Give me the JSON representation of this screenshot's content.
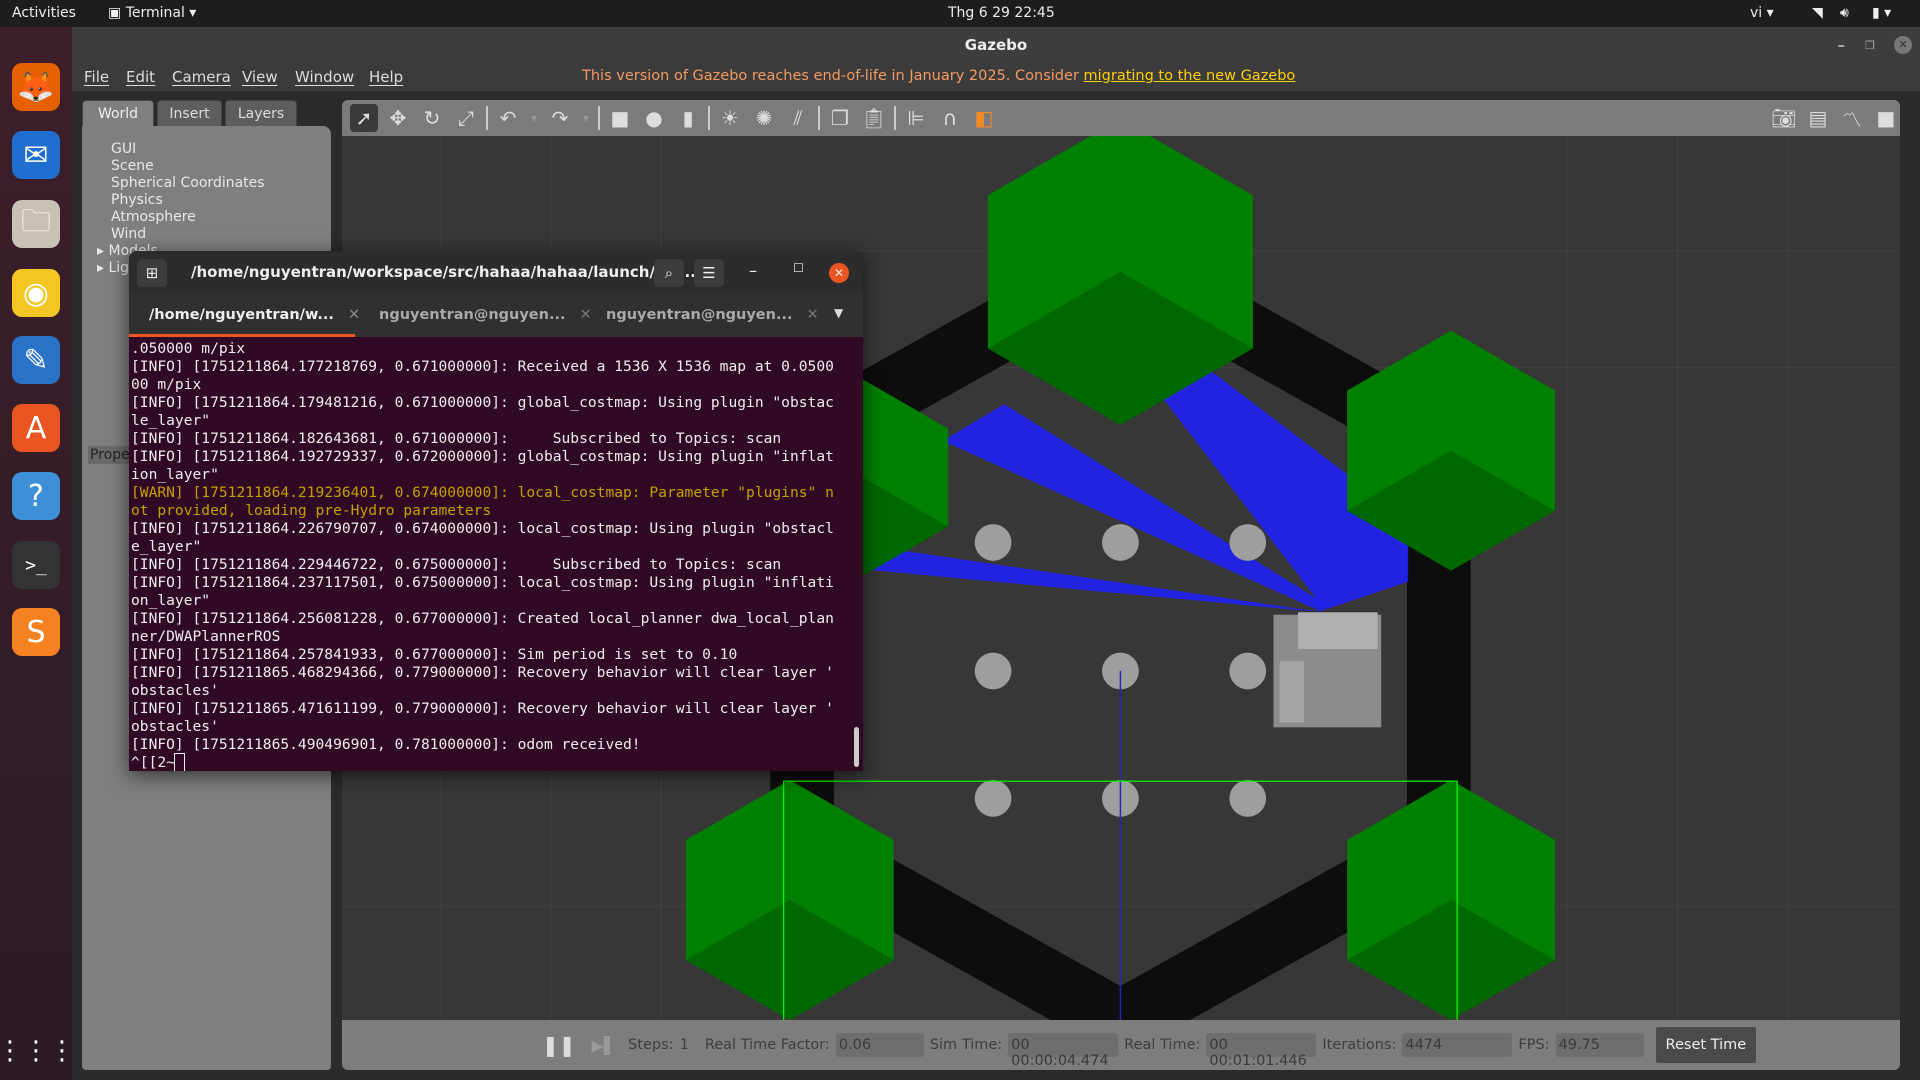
{
  "topbar": {
    "activities": "Activities",
    "app_menu": "Terminal",
    "clock": "Thg 6 29  22:45",
    "language": "vi"
  },
  "dock": {
    "items": [
      {
        "name": "firefox",
        "glyph": "🦊",
        "color": "#e66000"
      },
      {
        "name": "thunderbird",
        "glyph": "✉",
        "color": "#1f6fd0"
      },
      {
        "name": "files",
        "glyph": "🗀",
        "color": "#c8c2b6"
      },
      {
        "name": "rhythmbox",
        "glyph": "◉",
        "color": "#f3c623"
      },
      {
        "name": "libreoffice-writer",
        "glyph": "✎",
        "color": "#2a73c8"
      },
      {
        "name": "ubuntu-software",
        "glyph": "A",
        "color": "#e95420"
      },
      {
        "name": "help",
        "glyph": "?",
        "color": "#3d8fd8"
      },
      {
        "name": "terminal",
        "glyph": ">_",
        "color": "#333"
      },
      {
        "name": "sublime-text",
        "glyph": "S",
        "color": "#f58220"
      }
    ],
    "show_apps": "⋮⋮⋮"
  },
  "window": {
    "title": "Gazebo"
  },
  "menu": {
    "items": [
      "File",
      "Edit",
      "Camera",
      "View",
      "Window",
      "Help"
    ],
    "notice": "This version of Gazebo reaches end-of-life in January 2025. Consider ",
    "notice_link": "migrating to the new Gazebo"
  },
  "left_panel": {
    "tabs": [
      "World",
      "Insert",
      "Layers"
    ],
    "tree": [
      "GUI",
      "Scene",
      "Spherical Coordinates",
      "Physics",
      "Atmosphere",
      "Wind",
      "Models",
      "Lights"
    ],
    "properties_label": "Properties"
  },
  "toolbar": {
    "icons": [
      "select-arrow",
      "translate",
      "rotate",
      "scale",
      "undo",
      "undo-dropdown",
      "redo",
      "redo-dropdown",
      "box",
      "sphere",
      "cylinder",
      "point-light",
      "spot-light",
      "directional-light",
      "copy",
      "paste",
      "align",
      "snap",
      "view-angle",
      "screenshot",
      "log",
      "plot",
      "record"
    ]
  },
  "bottom_bar": {
    "steps_label": "Steps:",
    "steps_value": "1",
    "rtf_label": "Real Time Factor:",
    "rtf_value": "0.06",
    "sim_time_label": "Sim Time:",
    "sim_time_value": "00 00:00:04.474",
    "real_time_label": "Real Time:",
    "real_time_value": "00 00:01:01.446",
    "iterations_label": "Iterations:",
    "iterations_value": "4474",
    "fps_label": "FPS:",
    "fps_value": "49.75",
    "reset_label": "Reset Time"
  },
  "scene_colors": {
    "background": "#373737",
    "walls": "#0d0d0d",
    "obstacles": "#008000",
    "laser": "#1e1eff",
    "bbox": "#00ff00"
  },
  "terminal": {
    "title": "/home/nguyentran/workspace/src/hahaa/hahaa/launch/gaz...",
    "tabs": [
      "/home/nguyentran/w...",
      "nguyentran@nguyen...",
      "nguyentran@nguyen..."
    ],
    "lines": [
      {
        "t": ".050000 m/pix"
      },
      {
        "t": "[INFO] [1751211864.177218769, 0.671000000]: Received a 1536 X 1536 map at 0.0500"
      },
      {
        "t": "00 m/pix"
      },
      {
        "t": "[INFO] [1751211864.179481216, 0.671000000]: global_costmap: Using plugin \"obstac"
      },
      {
        "t": "le_layer\""
      },
      {
        "t": "[INFO] [1751211864.182643681, 0.671000000]:     Subscribed to Topics: scan"
      },
      {
        "t": "[INFO] [1751211864.192729337, 0.672000000]: global_costmap: Using plugin \"inflat"
      },
      {
        "t": "ion_layer\""
      },
      {
        "t": "[WARN] [1751211864.219236401, 0.674000000]: local_costmap: Parameter \"plugins\" n",
        "warn": true
      },
      {
        "t": "ot provided, loading pre-Hydro parameters",
        "warn": true
      },
      {
        "t": "[INFO] [1751211864.226790707, 0.674000000]: local_costmap: Using plugin \"obstacl"
      },
      {
        "t": "e_layer\""
      },
      {
        "t": "[INFO] [1751211864.229446722, 0.675000000]:     Subscribed to Topics: scan"
      },
      {
        "t": "[INFO] [1751211864.237117501, 0.675000000]: local_costmap: Using plugin \"inflati"
      },
      {
        "t": "on_layer\""
      },
      {
        "t": "[INFO] [1751211864.256081228, 0.677000000]: Created local_planner dwa_local_plan"
      },
      {
        "t": "ner/DWAPlannerROS"
      },
      {
        "t": "[INFO] [1751211864.257841933, 0.677000000]: Sim period is set to 0.10"
      },
      {
        "t": "[INFO] [1751211865.468294366, 0.779000000]: Recovery behavior will clear layer '"
      },
      {
        "t": "obstacles'"
      },
      {
        "t": "[INFO] [1751211865.471611199, 0.779000000]: Recovery behavior will clear layer '"
      },
      {
        "t": "obstacles'"
      },
      {
        "t": "[INFO] [1751211865.490496901, 0.781000000]: odom received!"
      }
    ],
    "prompt": "^[[2~"
  }
}
